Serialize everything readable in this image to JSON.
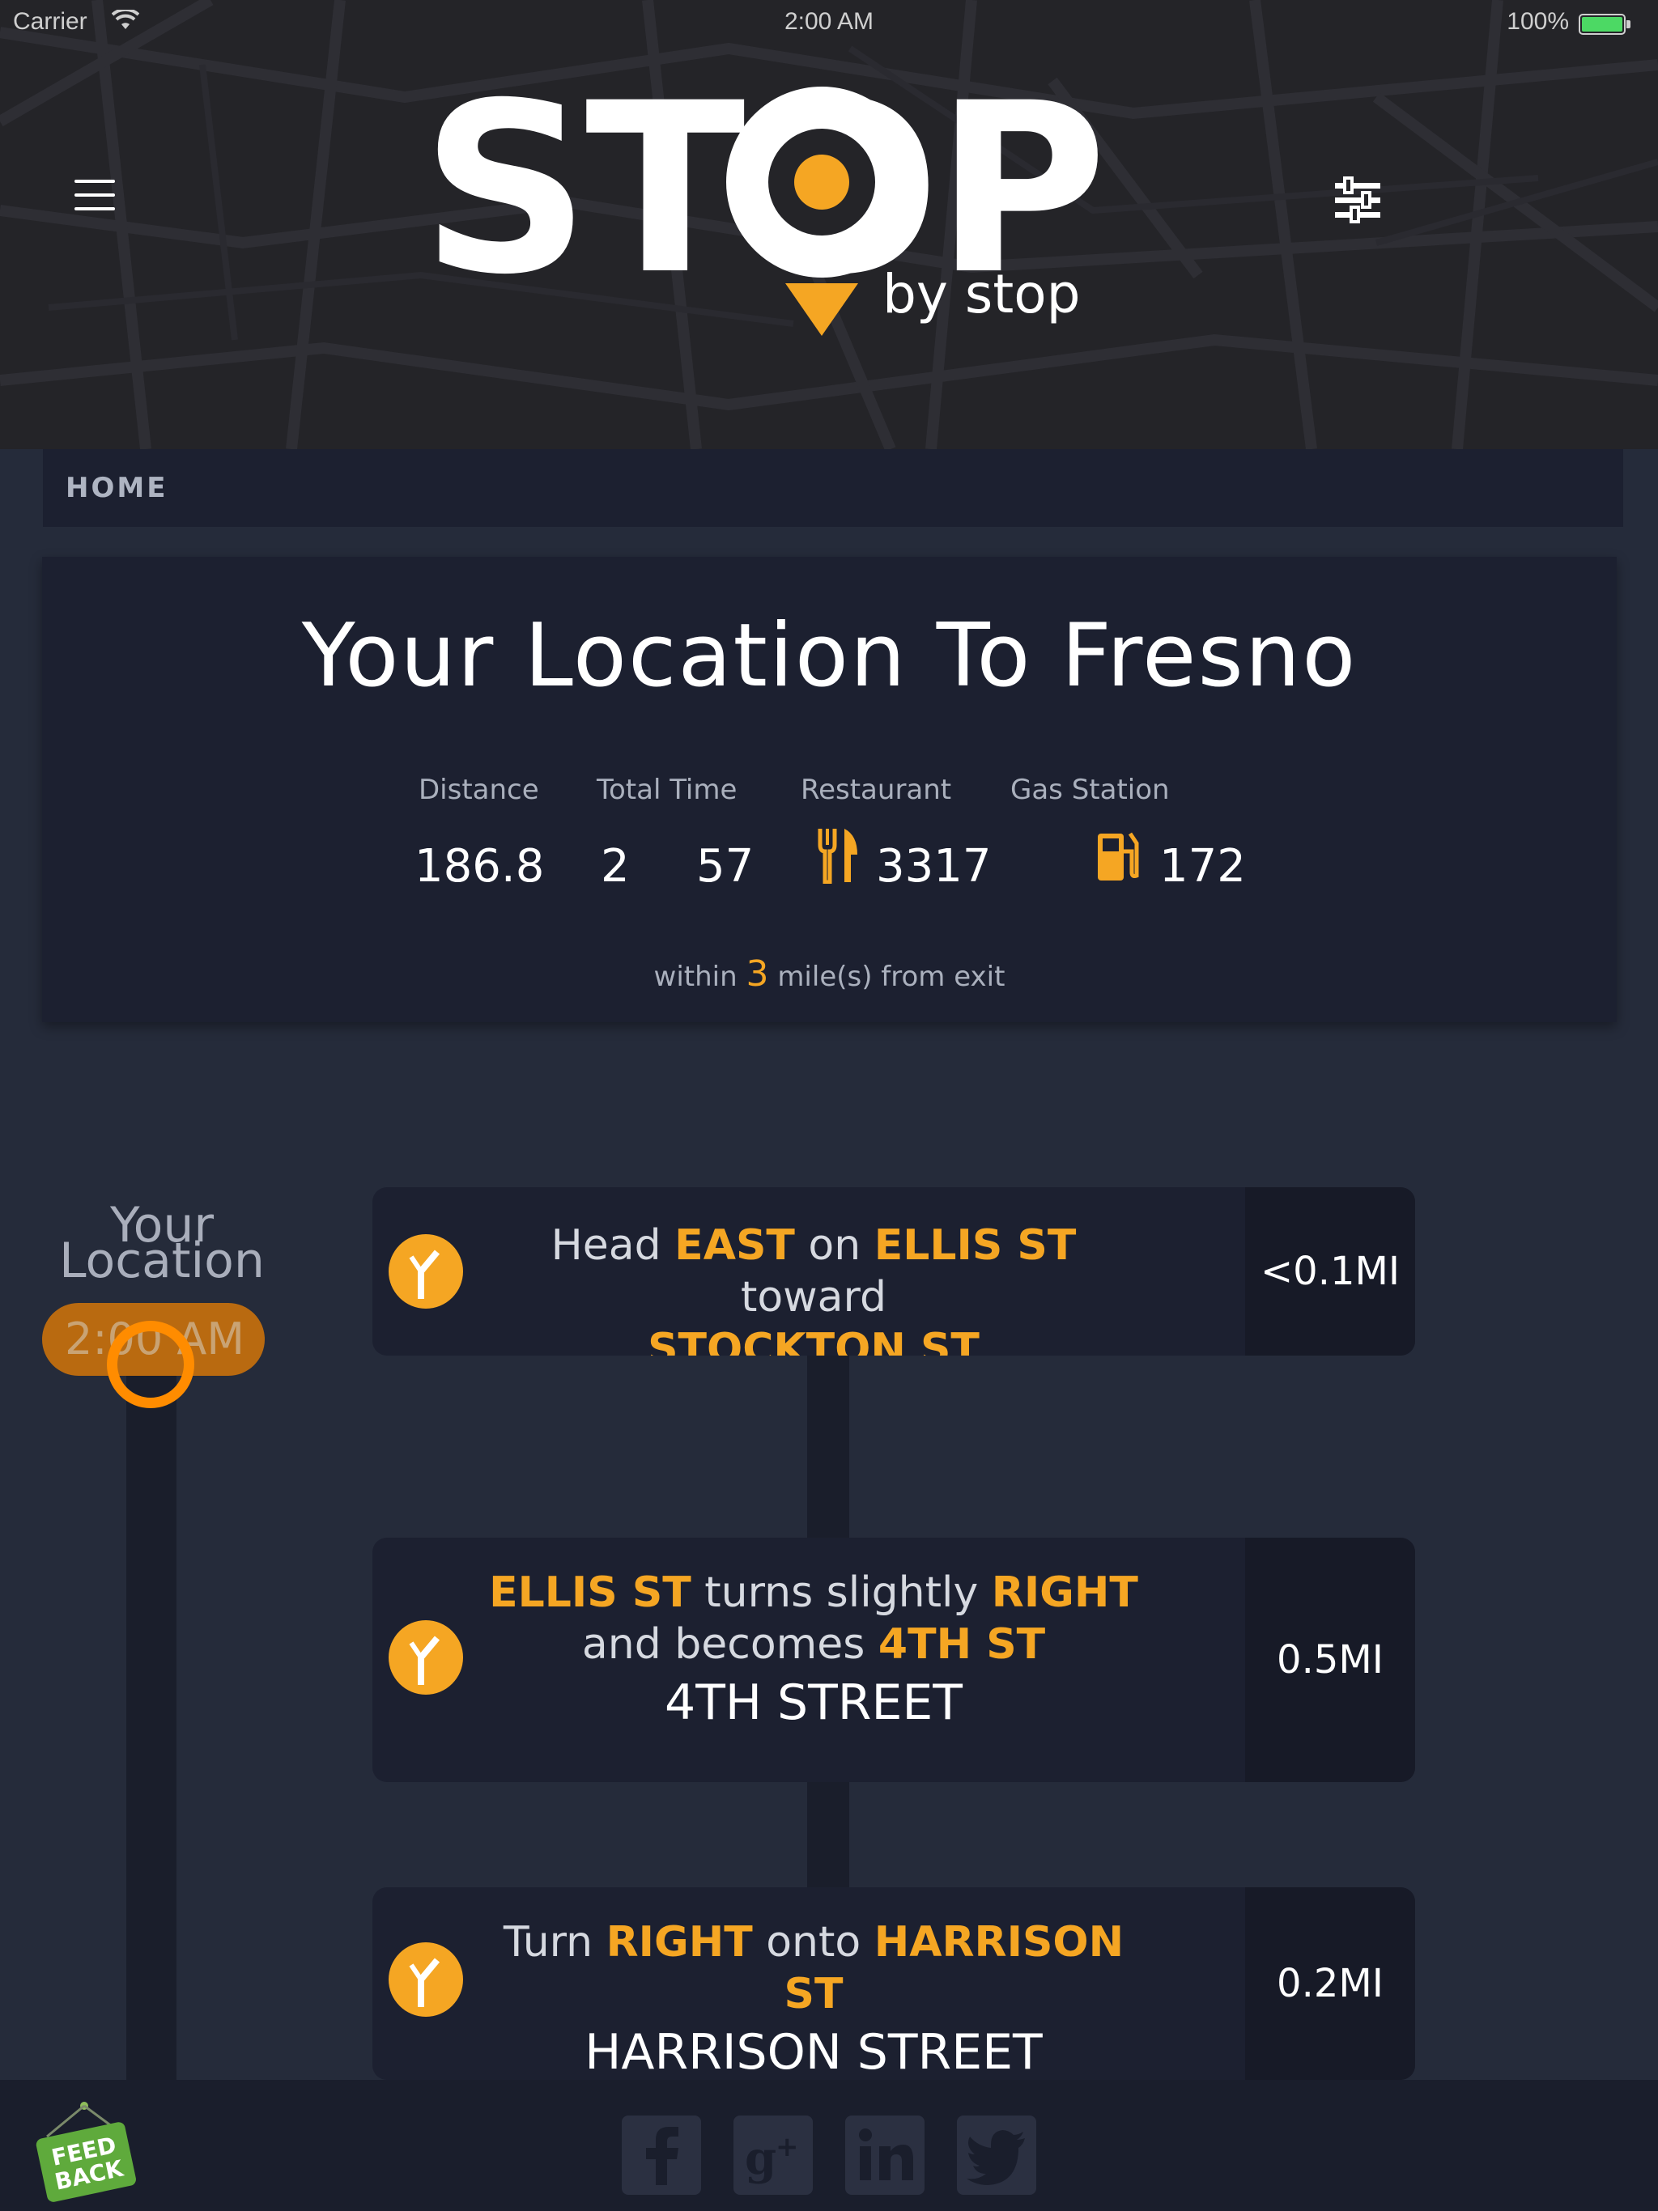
{
  "status_bar": {
    "carrier": "Carrier",
    "time": "2:00 AM",
    "battery": "100%",
    "wifi_icon": "wifi-icon",
    "battery_color": "#4cd964"
  },
  "header": {
    "logo_text": "STOP",
    "logo_sub": "by stop",
    "menu_icon": "hamburger-menu-icon",
    "filter_icon": "filter-sliders-icon",
    "accent_color": "#f5a623"
  },
  "breadcrumb": {
    "label": "HOME"
  },
  "summary": {
    "title": "Your Location To Fresno",
    "labels": {
      "distance": "Distance",
      "total_time": "Total Time",
      "restaurant": "Restaurant",
      "gas_station": "Gas Station"
    },
    "values": {
      "distance": "186.8",
      "hours": "2",
      "minutes": "57",
      "restaurants": "3317",
      "gas_stations": "172"
    },
    "within_prefix": "within",
    "within_miles": "3",
    "within_suffix": "mile(s) from exit"
  },
  "timeline": {
    "start_label_1": "Your",
    "start_label_2": "Location",
    "start_time": "2:00 AM"
  },
  "steps": [
    {
      "w1": "Head",
      "h1": "EAST",
      "w2": "on",
      "h2": "ELLIS ST",
      "w3": "toward",
      "h3": "STOCKTON ST",
      "distance": "<0.1MI"
    },
    {
      "h1": "ELLIS ST",
      "w1": "turns slightly",
      "h2": "RIGHT",
      "w2": "and becomes",
      "h3": "4TH ST",
      "street": "4TH STREET",
      "distance": "0.5MI"
    },
    {
      "w1": "Turn",
      "h1": "RIGHT",
      "w2": "onto",
      "h2": "HARRISON ST",
      "street": "HARRISON STREET",
      "distance": "0.2MI"
    }
  ],
  "footer": {
    "feedback_label_1": "FEED",
    "feedback_label_2": "BACK",
    "social_icons": [
      "facebook-icon",
      "google-plus-icon",
      "linkedin-icon",
      "twitter-icon"
    ]
  }
}
